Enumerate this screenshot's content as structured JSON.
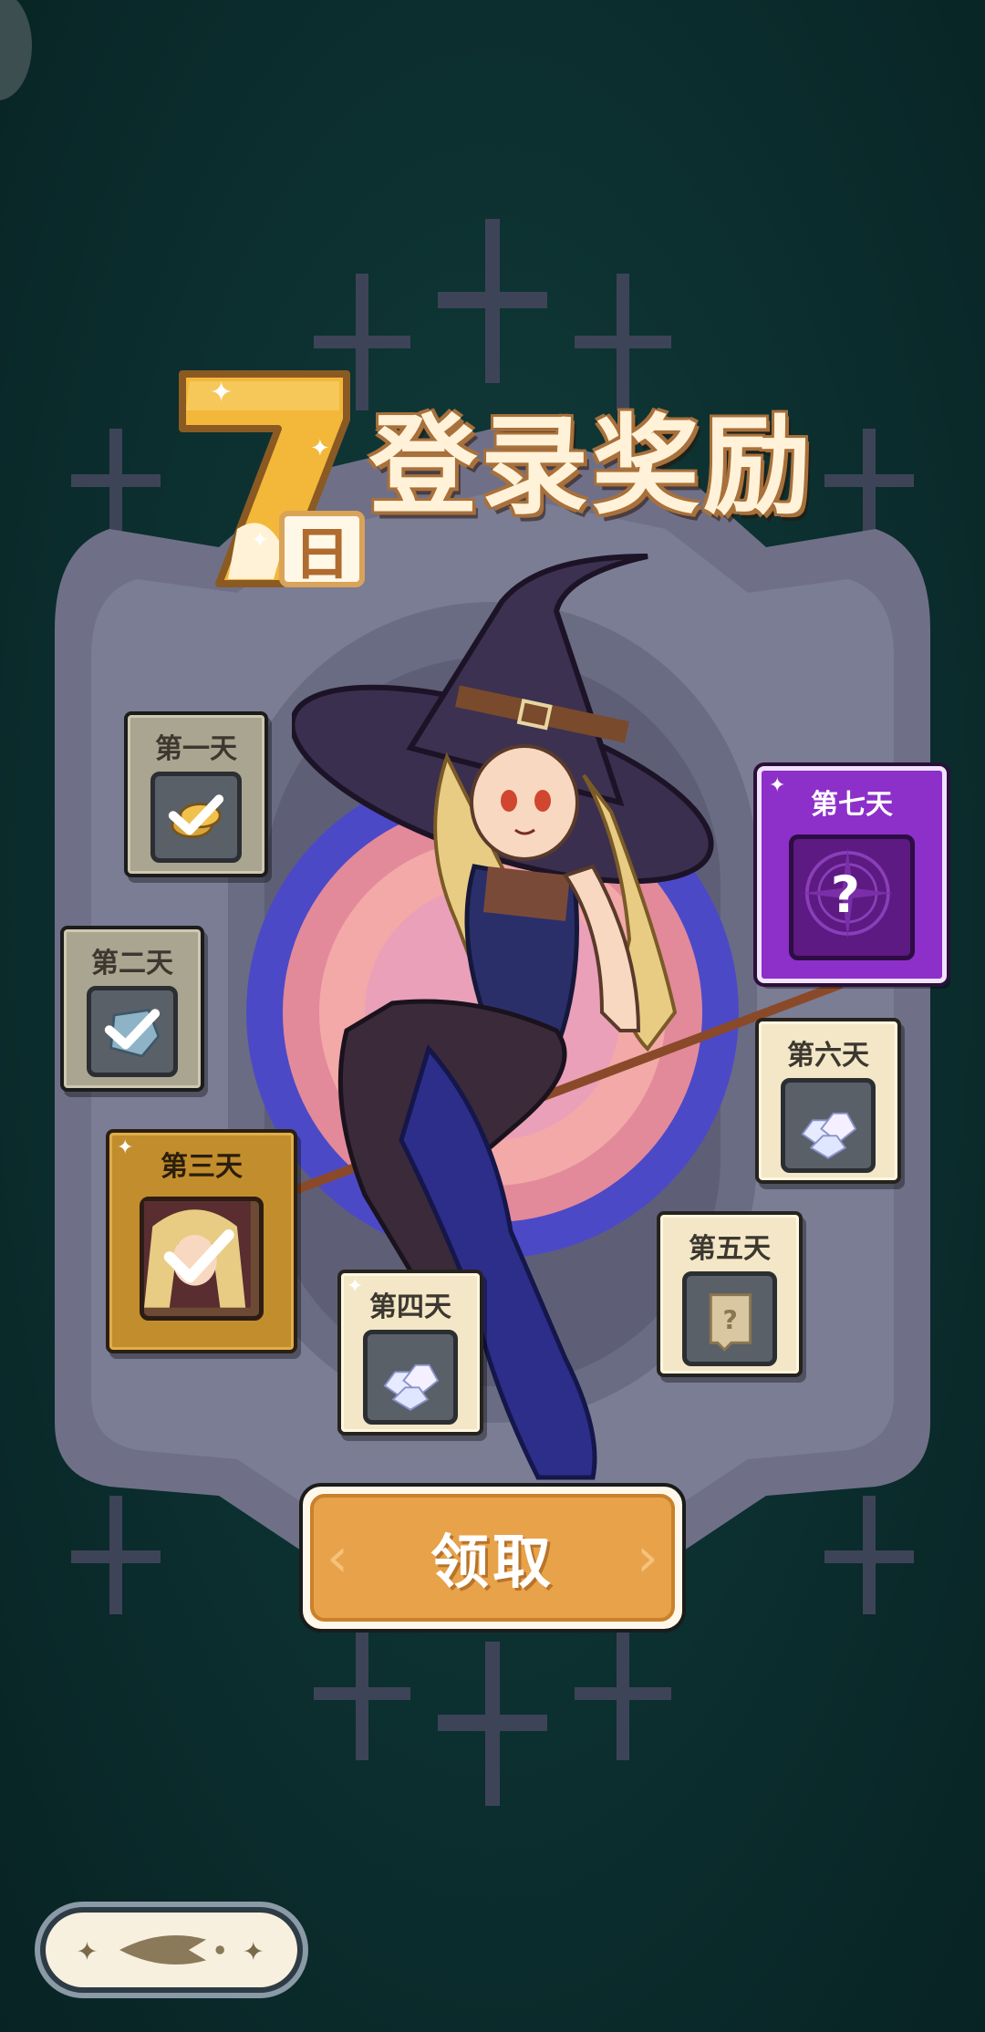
{
  "title": {
    "number": "7",
    "unit": "日",
    "text": "登录奖励"
  },
  "days": [
    {
      "label": "第一天",
      "reward": "coins",
      "claimed": true
    },
    {
      "label": "第二天",
      "reward": "stone",
      "claimed": true
    },
    {
      "label": "第三天",
      "reward": "character-portrait",
      "claimed": true
    },
    {
      "label": "第四天",
      "reward": "diamonds",
      "claimed": false
    },
    {
      "label": "第五天",
      "reward": "mystery-ticket",
      "claimed": false
    },
    {
      "label": "第六天",
      "reward": "diamonds",
      "claimed": false
    },
    {
      "label": "第七天",
      "reward": "mystery-reward",
      "claimed": false,
      "symbol": "?"
    }
  ],
  "claim_button": {
    "label": "领取"
  },
  "colors": {
    "accent": "#e7a24a",
    "special": "#8d2fc9",
    "background": "#0d3131"
  }
}
